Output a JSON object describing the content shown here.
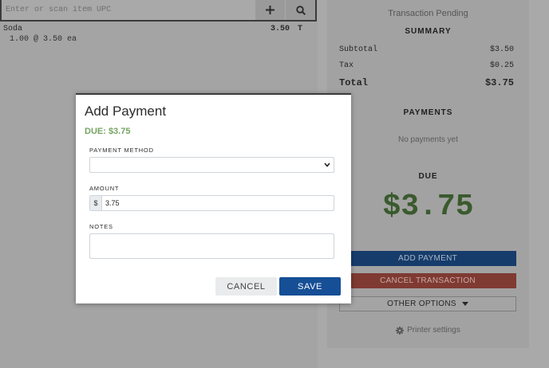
{
  "scan": {
    "placeholder": "Enter or scan item UPC",
    "add_icon": "plus-icon",
    "search_icon": "search-icon"
  },
  "cart": {
    "items": [
      {
        "name": "Soda",
        "price": "3.50",
        "tax_flag": "T",
        "qty_line": "1.00 @ 3.50 ea"
      }
    ]
  },
  "summary": {
    "status": "Transaction Pending",
    "heading": "SUMMARY",
    "subtotal_label": "Subtotal",
    "subtotal_value": "$3.50",
    "tax_label": "Tax",
    "tax_value": "$0.25",
    "total_label": "Total",
    "total_value": "$3.75",
    "payments_heading": "PAYMENTS",
    "no_payments": "No payments yet",
    "due_heading": "DUE",
    "due_amount": "$3.75",
    "add_payment_label": "ADD PAYMENT",
    "cancel_transaction_label": "CANCEL TRANSACTION",
    "other_options_label": "OTHER OPTIONS",
    "printer_settings_label": "Printer settings"
  },
  "modal": {
    "title": "Add Payment",
    "due_text": "DUE: $3.75",
    "payment_method_label": "PAYMENT METHOD",
    "payment_method_value": "",
    "amount_label": "AMOUNT",
    "amount_prefix": "$",
    "amount_value": "3.75",
    "notes_label": "NOTES",
    "notes_value": "",
    "cancel_label": "CANCEL",
    "save_label": "SAVE"
  },
  "colors": {
    "primary": "#164f96",
    "danger": "#7f3a32",
    "due_green": "#76a463",
    "due_green_dimmed": "#3a5a2d",
    "overlay_gray": "#a4a4a4"
  }
}
